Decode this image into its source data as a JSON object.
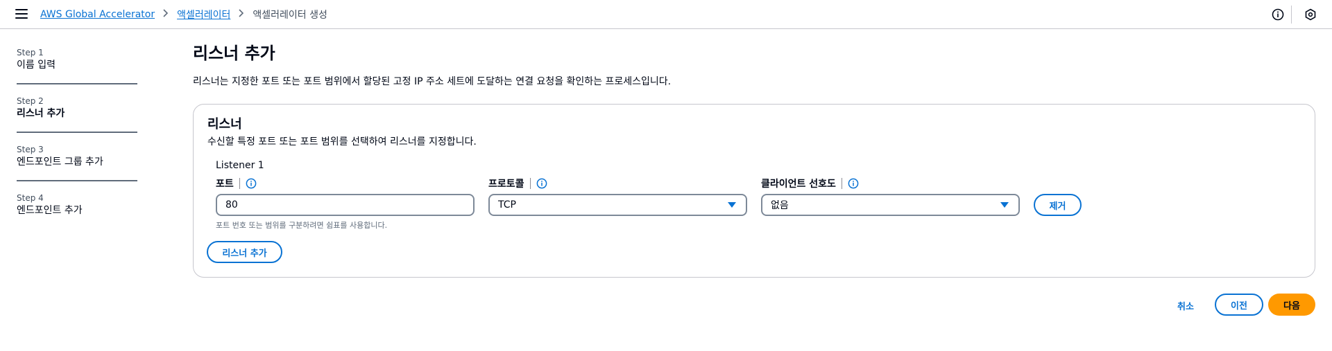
{
  "header": {
    "breadcrumbs": [
      "AWS Global Accelerator",
      "액셀러레이터",
      "액셀러레이터 생성"
    ],
    "menu_icon": "hamburger-icon",
    "info_icon": "info-icon",
    "settings_icon": "shield-gear-icon"
  },
  "steps": [
    {
      "num": "Step 1",
      "label": "이름 입력"
    },
    {
      "num": "Step 2",
      "label": "리스너 추가"
    },
    {
      "num": "Step 3",
      "label": "엔드포인트 그룹 추가"
    },
    {
      "num": "Step 4",
      "label": "엔드포인트 추가"
    }
  ],
  "page": {
    "title": "리스너 추가",
    "description": "리스너는 지정한 포트 또는 포트 범위에서 할당된 고정 IP 주소 세트에 도달하는 연결 요청을 확인하는 프로세스입니다."
  },
  "listener_panel": {
    "title": "리스너",
    "description": "수신할 특정 포트 또는 포트 범위를 선택하여 리스너를 지정합니다.",
    "listener_name": "Listener 1",
    "port_label": "포트",
    "port_value": "80",
    "port_hint": "포트 번호 또는 범위를 구분하려면 쉼표를 사용합니다.",
    "protocol_label": "프로토콜",
    "protocol_value": "TCP",
    "affinity_label": "클라이언트 선호도",
    "affinity_value": "없음",
    "remove_label": "제거",
    "add_listener_label": "리스너 추가"
  },
  "footer": {
    "cancel_label": "취소",
    "previous_label": "이전",
    "next_label": "다음"
  },
  "colors": {
    "accent": "#0972d3",
    "primary_button": "#ff9900",
    "border": "#c6c6cd"
  }
}
